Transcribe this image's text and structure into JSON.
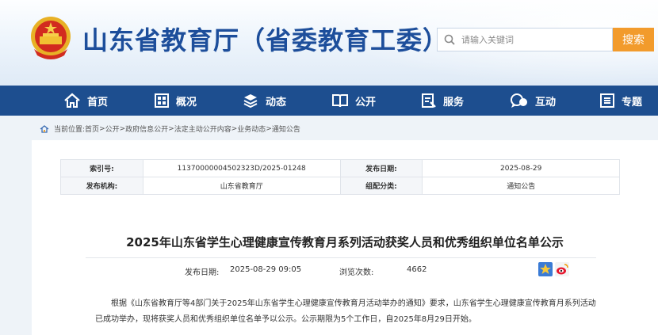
{
  "header": {
    "site_title": "山东省教育厅（省委教育工委）",
    "search": {
      "placeholder": "请输入关键词",
      "button_label": "搜索"
    }
  },
  "nav": {
    "items": [
      {
        "label": "首页",
        "icon": "home-icon"
      },
      {
        "label": "概况",
        "icon": "overview-icon"
      },
      {
        "label": "动态",
        "icon": "news-icon"
      },
      {
        "label": "公开",
        "icon": "book-icon"
      },
      {
        "label": "服务",
        "icon": "service-icon"
      },
      {
        "label": "互动",
        "icon": "chat-icon"
      },
      {
        "label": "专题",
        "icon": "topic-icon"
      }
    ]
  },
  "breadcrumb": {
    "prefix": "当前位置:",
    "items": [
      "首页",
      "公开",
      "政府信息公开",
      "法定主动公开内容",
      "业务动态",
      "通知公告"
    ],
    "separator": ">"
  },
  "meta_table": {
    "rows": [
      {
        "k1": "索引号:",
        "v1": "11370000004502323D/2025-01248",
        "k2": "发布日期:",
        "v2": "2025-08-29"
      },
      {
        "k1": "发布机构:",
        "v1": "山东省教育厅",
        "k2": "组配分类:",
        "v2": "通知公告"
      }
    ]
  },
  "article": {
    "title": "2025年山东省学生心理健康宣传教育月系列活动获奖人员和优秀组织单位名单公示",
    "publish_label": "发布日期:",
    "publish_value": "2025-08-29 09:05",
    "views_label": "浏览次数:",
    "views_value": "4662",
    "body": "根据《山东省教育厅等4部门关于2025年山东省学生心理健康宣传教育月活动举办的通知》要求，山东省学生心理健康宣传教育月系列活动已成功举办，现将获奖人员和优秀组织单位名单予以公示。公示期限为5个工作日，自2025年8月29日开始。"
  },
  "colors": {
    "brand_blue": "#1d4e9b",
    "nav_bg": "#1d4e8f",
    "search_button": "#f29b2c"
  }
}
